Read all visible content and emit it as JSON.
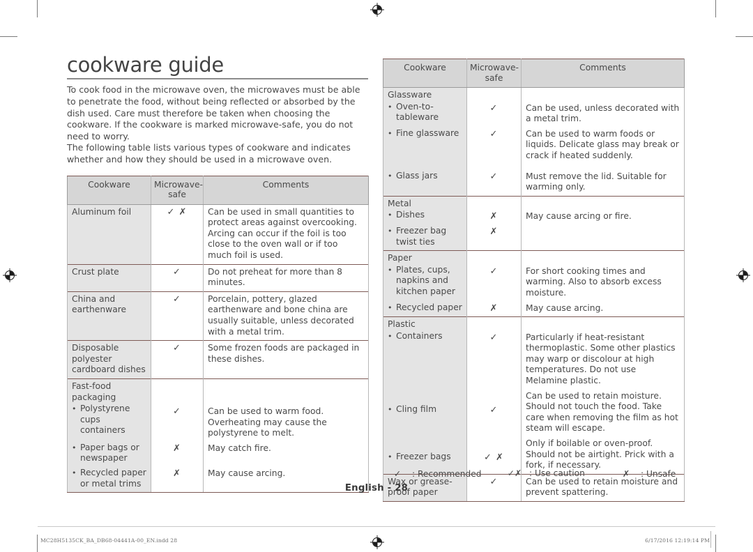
{
  "document": {
    "title": "cookware guide",
    "intro": "To cook food in the microwave oven, the microwaves must be able to penetrate the food, without being reflected or absorbed by the dish used. Care must therefore be taken when choosing the cookware. If the cookware is marked microwave-safe, you do not need to worry.\nThe following table lists various types of cookware and indicates whether and how they should be used in a microwave oven.",
    "page_number": "English - 28"
  },
  "symbols": {
    "check": "✓",
    "cross": "✗",
    "check_cross": "✓ ✗",
    "bullet": "•"
  },
  "table_headers": {
    "cookware": "Cookware",
    "microwave_safe": "Microwave-safe",
    "microwave_safe_line1": "Microwave-",
    "microwave_safe_line2": "safe",
    "comments": "Comments"
  },
  "left_table": {
    "rows": [
      {
        "name": "Aluminum foil",
        "safe": "✓ ✗",
        "comment": "Can be used in small quantities to protect areas against overcooking. Arcing can occur if the foil is too close to the oven wall or if too much foil is used."
      },
      {
        "name": "Crust plate",
        "safe": "✓",
        "comment": "Do not preheat for more than 8 minutes."
      },
      {
        "name": "China and earthenware",
        "safe": "✓",
        "comment": "Porcelain, pottery, glazed earthenware and bone china are usually suitable, unless decorated with a metal trim."
      },
      {
        "name": "Disposable polyester cardboard dishes",
        "safe": "✓",
        "comment": "Some frozen foods are packaged in these dishes."
      },
      {
        "name": "Fast-food packaging",
        "safe": "",
        "comment": "",
        "is_group_header": true
      },
      {
        "name": "Polystyrene cups containers",
        "safe": "✓",
        "comment": "Can be used to warm food. Overheating may cause the polystyrene to melt.",
        "bulleted": true
      },
      {
        "name": "Paper bags or newspaper",
        "safe": "✗",
        "comment": "May catch fire.",
        "bulleted": true
      },
      {
        "name": "Recycled paper or metal trims",
        "safe": "✗",
        "comment": "May cause arcing.",
        "bulleted": true
      }
    ]
  },
  "right_table": {
    "groups": [
      {
        "title": "Glassware",
        "rows": [
          {
            "name": "Oven-to-tableware",
            "safe": "✓",
            "comment": "Can be used, unless decorated with a metal trim.",
            "bulleted": true
          },
          {
            "name": "Fine glassware",
            "safe": "✓",
            "comment": "Can be used to warm foods or liquids. Delicate glass may break or crack if heated suddenly.",
            "bulleted": true
          },
          {
            "name": "Glass jars",
            "safe": "✓",
            "comment": "Must remove the lid. Suitable for warming only.",
            "bulleted": true
          }
        ]
      },
      {
        "title": "Metal",
        "rows": [
          {
            "name": "Dishes",
            "safe": "✗",
            "comment": "May cause arcing or fire.",
            "bulleted": true
          },
          {
            "name": "Freezer bag twist ties",
            "safe": "✗",
            "comment": "",
            "bulleted": true
          }
        ]
      },
      {
        "title": "Paper",
        "rows": [
          {
            "name": "Plates, cups, napkins and kitchen paper",
            "safe": "✓",
            "comment": "For short cooking times and warming. Also to absorb excess moisture.",
            "bulleted": true
          },
          {
            "name": "Recycled paper",
            "safe": "✗",
            "comment": "May cause arcing.",
            "bulleted": true
          }
        ]
      },
      {
        "title": "Plastic",
        "rows": [
          {
            "name": "Containers",
            "safe": "✓",
            "comment": "Particularly if heat-resistant thermoplastic. Some other plastics may warp or discolour at high temperatures. Do not use Melamine plastic.",
            "bulleted": true
          },
          {
            "name": "Cling film",
            "safe": "✓",
            "comment": "Can be used to retain moisture. Should not touch the food. Take care when removing the film as hot steam will escape.",
            "bulleted": true
          },
          {
            "name": "Freezer bags",
            "safe": "✓ ✗",
            "comment": "Only if boilable or oven-proof. Should not be airtight. Prick with a fork, if necessary.",
            "bulleted": true
          }
        ]
      },
      {
        "title": "",
        "rows": [
          {
            "name": "Wax or grease-proof paper",
            "safe": "✓",
            "comment": "Can be used to retain moisture and prevent spattering.",
            "bulleted": false
          }
        ]
      }
    ]
  },
  "legend": [
    {
      "symbol": "✓",
      "label": ": Recommended"
    },
    {
      "symbol": "✓✗",
      "label": ": Use caution"
    },
    {
      "symbol": "✗",
      "label": ": Unsafe"
    }
  ],
  "print_footer": {
    "left": "MC28H5135CK_BA_DB68-04441A-00_EN.indd   28",
    "right": "6/17/2016   12:19:14 PM"
  },
  "colors": {
    "header_fill": "#d6d6d6",
    "name_fill": "#e4e4e4",
    "group_border": "#7d5a55",
    "cell_border": "#b7b7b7",
    "text": "#4a4a4a"
  }
}
